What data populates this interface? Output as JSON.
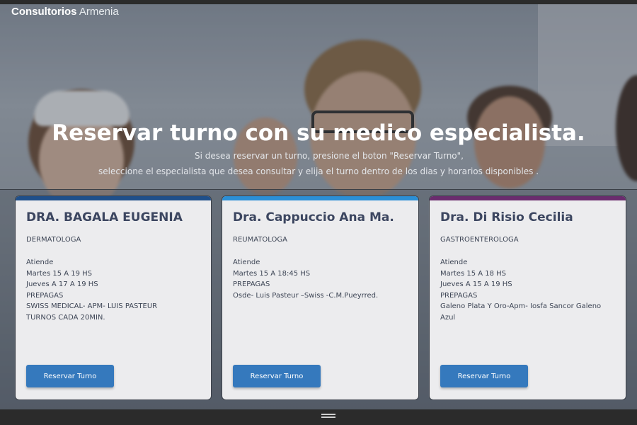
{
  "brand": {
    "name_bold": "Consultorios",
    "name_light": "Armenia"
  },
  "hero": {
    "title": "Reservar turno con su medico especialista.",
    "subtitle_line1": "Si desea reservar un turno, presione el boton \"Reservar Turno\",",
    "subtitle_line2": "seleccione el especialista que desea consultar y elija el turno dentro de los dias y horarios disponibles ."
  },
  "colors": {
    "card1_stripe": "#1f4f8a",
    "card2_stripe": "#2b8fd6",
    "card3_stripe": "#6a2c6e",
    "button": "#3579bd"
  },
  "cards": [
    {
      "name": "DRA. BAGALA EUGENIA",
      "specialty": "DERMATOLOGA",
      "lines": [
        "Atiende",
        "Martes 15 A 19 HS",
        "Jueves A 17 A 19 HS",
        "PREPAGAS",
        "SWISS MEDICAL- APM- LUIS PASTEUR",
        "TURNOS CADA 20MIN."
      ],
      "button": "Reservar Turno"
    },
    {
      "name": "Dra. Cappuccio Ana Ma.",
      "specialty": "REUMATOLOGA",
      "lines": [
        "Atiende",
        "Martes 15 A 18:45 HS",
        "PREPAGAS",
        "Osde- Luis Pasteur –Swiss -C.M.Pueyrred."
      ],
      "button": "Reservar Turno"
    },
    {
      "name": "Dra. Di Risio Cecilia",
      "specialty": "GASTROENTEROLOGA",
      "lines": [
        "Atiende",
        "Martes 15 A 18 HS",
        "Jueves A 15 A 19 HS",
        "PREPAGAS",
        "Galeno Plata Y Oro-Apm- Iosfa Sancor Galeno Azul"
      ],
      "button": "Reservar Turno"
    }
  ],
  "icons": {
    "bottom_handle": "drag-handle-icon"
  }
}
